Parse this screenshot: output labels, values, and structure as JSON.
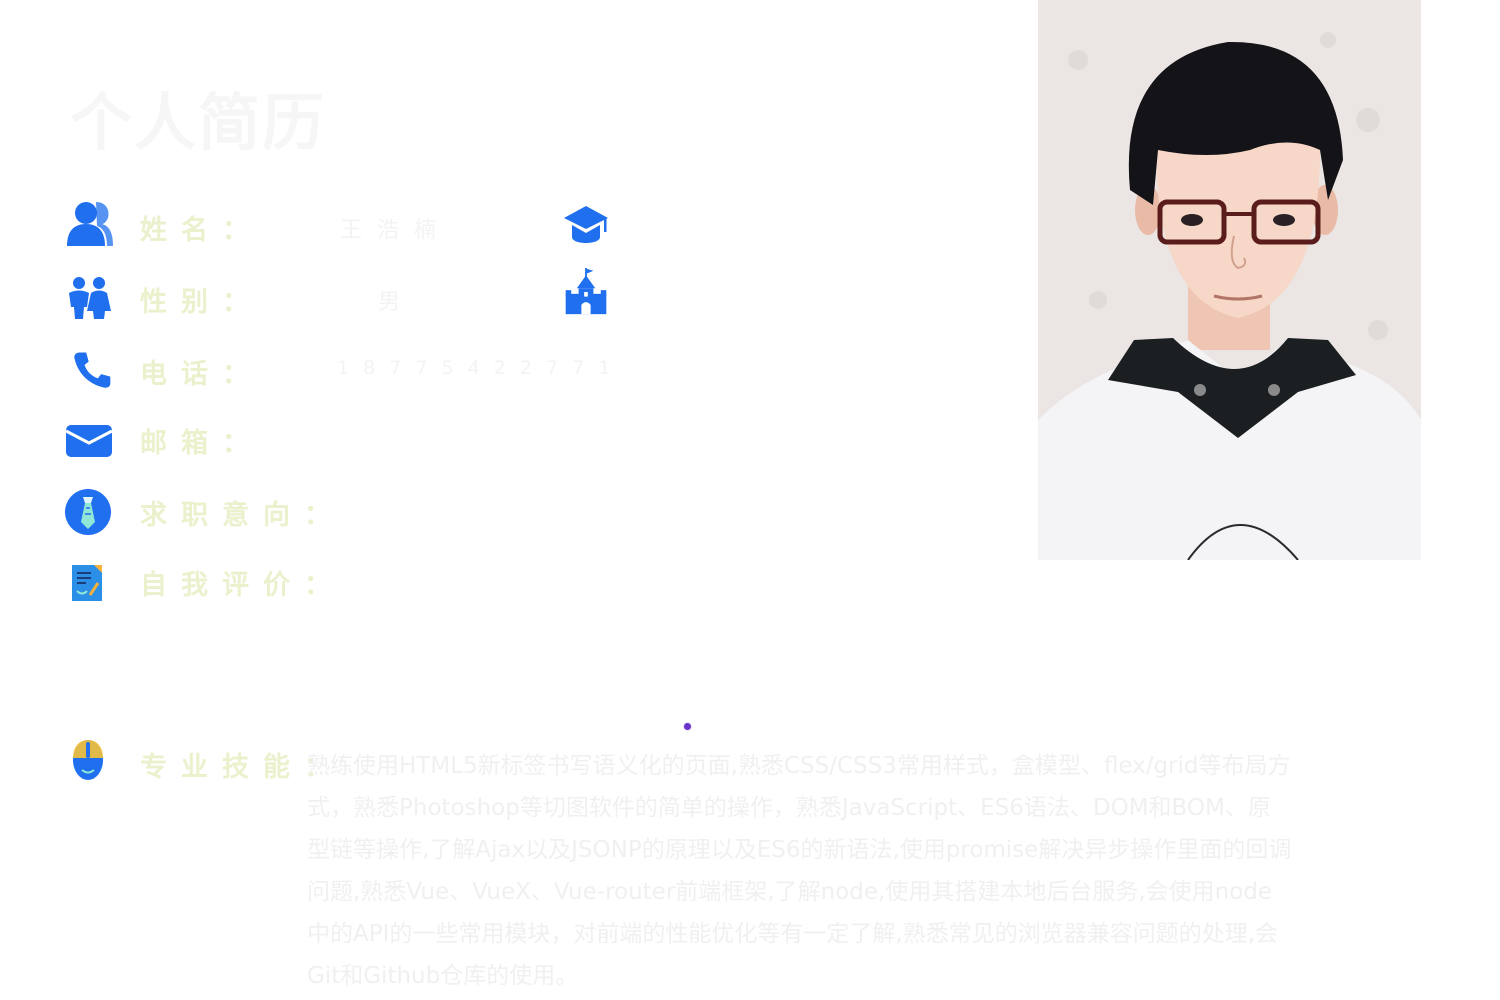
{
  "header": {
    "title": "个人简历"
  },
  "info": {
    "name_label": "姓名：",
    "name_value": "王 浩 楠",
    "gender_label": "性别：",
    "gender_value": "男",
    "phone_label": "电话：",
    "phone_value": "1 8 7 7 5 4 2 2 7 7 1",
    "email_label": "邮箱：",
    "job_label": "求职意向：",
    "eval_label": "自我评价：",
    "skills_label": "专业技能：",
    "skills_text": "熟练使用HTML5新标签书写语义化的页面,熟悉CSS/CSS3常用样式，盒模型、flex/grid等布局方式，熟悉Photoshop等切图软件的简单的操作，熟悉JavaScript、ES6语法、DOM和BOM、原型链等操作,了解Ajax以及JSONP的原理以及ES6的新语法,使用promise解决异步操作里面的回调问题,熟悉Vue、VueX、Vue-router前端框架,了解node,使用其搭建本地后台服务,会使用node中的API的一些常用模块，对前端的性能优化等有一定了解,熟悉常见的浏览器兼容问题的处理,会Git和Github仓库的使用。"
  },
  "colors": {
    "icon_blue": "#1f6fee",
    "icon_light_blue": "#3d9bf5",
    "label_color": "#eaf1cc",
    "dot_color": "#6b35c9"
  },
  "icons": {
    "name": "user-icon",
    "gender": "people-icon",
    "phone": "phone-icon",
    "email": "mail-icon",
    "job": "tie-icon",
    "evaluation": "notepad-icon",
    "skills": "mouse-icon",
    "education": "graduation-cap-icon",
    "school": "castle-icon"
  }
}
